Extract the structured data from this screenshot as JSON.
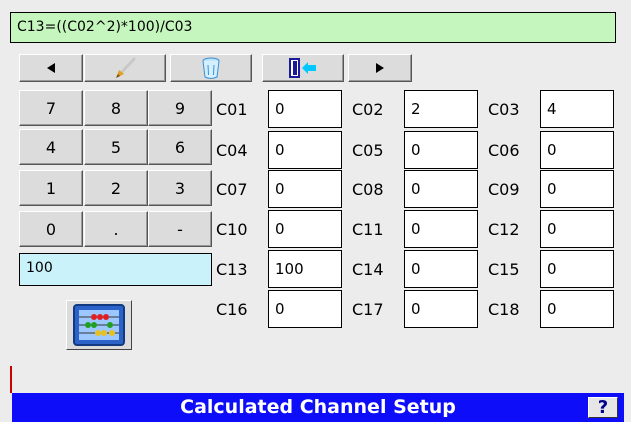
{
  "formula": "C13=((C02^2)*100)/C03",
  "toolbar": {
    "prev_icon": "left-arrow-icon",
    "brush_icon": "paintbrush-icon",
    "clear_icon": "trash-can-icon",
    "exit_icon": "exit-door-icon",
    "next_icon": "right-arrow-icon"
  },
  "keypad": [
    [
      "7",
      "8",
      "9"
    ],
    [
      "4",
      "5",
      "6"
    ],
    [
      "1",
      "2",
      "3"
    ],
    [
      "0",
      ".",
      "-"
    ]
  ],
  "entry_value": "100",
  "channels": [
    [
      {
        "label": "C01",
        "value": "0"
      },
      {
        "label": "C02",
        "value": "2"
      },
      {
        "label": "C03",
        "value": "4"
      }
    ],
    [
      {
        "label": "C04",
        "value": "0"
      },
      {
        "label": "C05",
        "value": "0"
      },
      {
        "label": "C06",
        "value": "0"
      }
    ],
    [
      {
        "label": "C07",
        "value": "0"
      },
      {
        "label": "C08",
        "value": "0"
      },
      {
        "label": "C09",
        "value": "0"
      }
    ],
    [
      {
        "label": "C10",
        "value": "0"
      },
      {
        "label": "C11",
        "value": "0"
      },
      {
        "label": "C12",
        "value": "0"
      }
    ],
    [
      {
        "label": "C13",
        "value": "100"
      },
      {
        "label": "C14",
        "value": "0"
      },
      {
        "label": "C15",
        "value": "0"
      }
    ],
    [
      {
        "label": "C16",
        "value": "0"
      },
      {
        "label": "C17",
        "value": "0"
      },
      {
        "label": "C18",
        "value": "0"
      }
    ]
  ],
  "calculator_icon": "abacus-icon",
  "status": {
    "title": "Calculated Channel Setup",
    "help_label": "?"
  },
  "colors": {
    "formula_bg": "#c5f6bd",
    "entry_bg": "#c9f2fb",
    "statusbar_bg": "#0d0dfa"
  }
}
